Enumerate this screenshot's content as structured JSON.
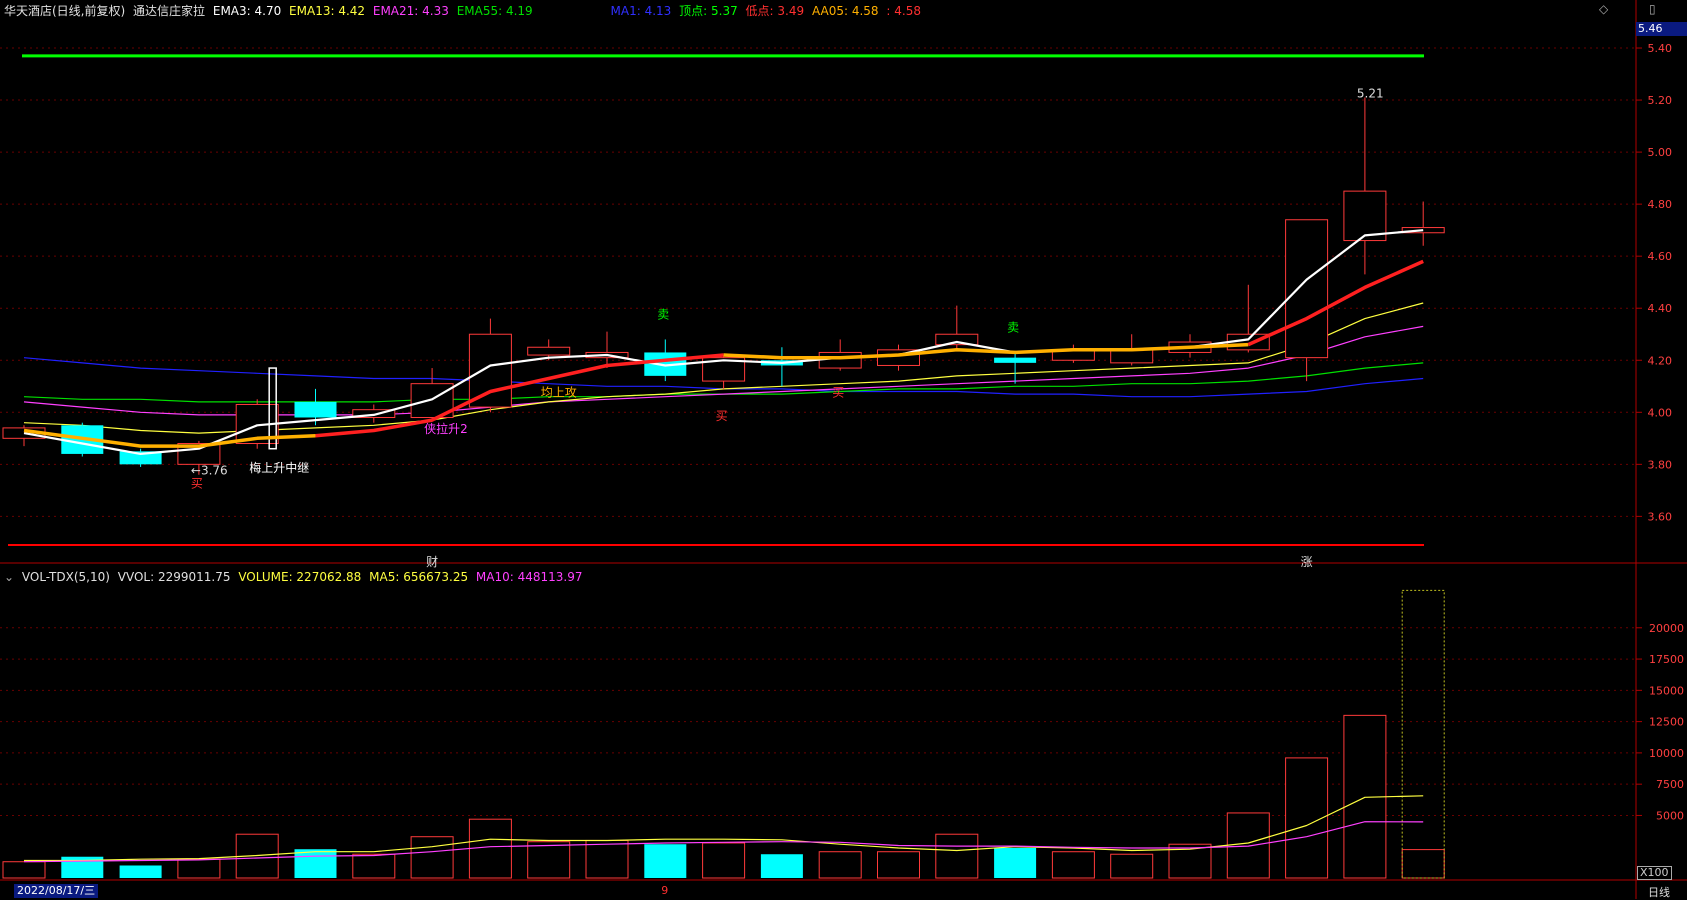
{
  "main_header": {
    "stock": "华天酒店(日线,前复权)",
    "indicator": "通达信庄家拉",
    "ema3": "EMA3: 4.70",
    "ema13": "EMA13: 4.42",
    "ema21": "EMA21: 4.33",
    "ema55": "EMA55: 4.19",
    "ma1": "MA1: 4.13",
    "top": "顶点: 5.37",
    "low": "低点: 3.49",
    "aa05": "AA05: 4.58",
    "aa05_tail": ": 4.58"
  },
  "vol_header": {
    "name": "VOL-TDX(5,10)",
    "vvol": "VVOL: 2299011.75",
    "volume": "VOLUME: 227062.88",
    "ma5": "MA5: 656673.25",
    "ma10": "MA10: 448113.97"
  },
  "labels": {
    "price_box": "5.46",
    "date": "2022/08/17/三",
    "scale": "X100",
    "period": "日线",
    "diamond_icon": "◇",
    "window_icon": "▯"
  },
  "colors": {
    "bg": "#000000",
    "up": "#ff3a3a",
    "down": "#00ffff",
    "ema3": "#ffffff",
    "ema13": "#ffff40",
    "ema21": "#ff40ff",
    "ema55": "#00e000",
    "ma1": "#2020ff",
    "aa05": "#ff2020",
    "top_line": "#00ff00",
    "low_line": "#ff0000"
  },
  "chart_data": [
    {
      "type": "candlestick",
      "title": "华天酒店(日线,前复权)",
      "y_ticks": [
        3.6,
        3.8,
        4.0,
        4.2,
        4.4,
        4.6,
        4.8,
        5.0,
        5.2,
        5.4
      ],
      "ylim": [
        3.44,
        5.5
      ],
      "top_line": 5.37,
      "low_line": 3.49,
      "candles": [
        {
          "o": 3.9,
          "c": 3.94,
          "h": 3.95,
          "l": 3.87
        },
        {
          "o": 3.95,
          "c": 3.84,
          "h": 3.96,
          "l": 3.83
        },
        {
          "o": 3.85,
          "c": 3.8,
          "h": 3.86,
          "l": 3.79
        },
        {
          "o": 3.8,
          "c": 3.88,
          "h": 3.89,
          "l": 3.76
        },
        {
          "o": 3.88,
          "c": 4.03,
          "h": 4.05,
          "l": 3.86
        },
        {
          "o": 4.04,
          "c": 3.98,
          "h": 4.09,
          "l": 3.95
        },
        {
          "o": 3.98,
          "c": 4.01,
          "h": 4.03,
          "l": 3.96
        },
        {
          "o": 3.98,
          "c": 4.11,
          "h": 4.17,
          "l": 3.97
        },
        {
          "o": 4.02,
          "c": 4.3,
          "h": 4.36,
          "l": 4.0
        },
        {
          "o": 4.22,
          "c": 4.25,
          "h": 4.28,
          "l": 4.2
        },
        {
          "o": 4.21,
          "c": 4.23,
          "h": 4.31,
          "l": 4.17
        },
        {
          "o": 4.23,
          "c": 4.14,
          "h": 4.28,
          "l": 4.12
        },
        {
          "o": 4.12,
          "c": 4.21,
          "h": 4.22,
          "l": 4.09
        },
        {
          "o": 4.2,
          "c": 4.18,
          "h": 4.25,
          "l": 4.1
        },
        {
          "o": 4.17,
          "c": 4.23,
          "h": 4.28,
          "l": 4.16
        },
        {
          "o": 4.18,
          "c": 4.24,
          "h": 4.26,
          "l": 4.16
        },
        {
          "o": 4.26,
          "c": 4.3,
          "h": 4.41,
          "l": 4.24
        },
        {
          "o": 4.21,
          "c": 4.19,
          "h": 4.23,
          "l": 4.11
        },
        {
          "o": 4.2,
          "c": 4.24,
          "h": 4.26,
          "l": 4.19
        },
        {
          "o": 4.19,
          "c": 4.24,
          "h": 4.3,
          "l": 4.18
        },
        {
          "o": 4.23,
          "c": 4.27,
          "h": 4.3,
          "l": 4.21
        },
        {
          "o": 4.24,
          "c": 4.3,
          "h": 4.49,
          "l": 4.23
        },
        {
          "o": 4.21,
          "c": 4.74,
          "h": 4.74,
          "l": 4.12
        },
        {
          "o": 4.66,
          "c": 4.85,
          "h": 5.21,
          "l": 4.53
        },
        {
          "o": 4.69,
          "c": 4.71,
          "h": 4.81,
          "l": 4.64
        }
      ],
      "ema3": [
        3.92,
        3.88,
        3.84,
        3.86,
        3.95,
        3.97,
        3.99,
        4.05,
        4.18,
        4.21,
        4.22,
        4.18,
        4.2,
        4.19,
        4.21,
        4.22,
        4.27,
        4.23,
        4.24,
        4.24,
        4.25,
        4.28,
        4.51,
        4.68,
        4.7
      ],
      "ema13": [
        3.96,
        3.95,
        3.93,
        3.92,
        3.93,
        3.94,
        3.95,
        3.97,
        4.01,
        4.04,
        4.06,
        4.07,
        4.09,
        4.1,
        4.11,
        4.12,
        4.14,
        4.15,
        4.16,
        4.17,
        4.18,
        4.19,
        4.26,
        4.36,
        4.42
      ],
      "ema21": [
        4.04,
        4.02,
        4.0,
        3.99,
        3.99,
        3.99,
        3.99,
        4.0,
        4.02,
        4.04,
        4.05,
        4.06,
        4.07,
        4.08,
        4.09,
        4.1,
        4.11,
        4.12,
        4.13,
        4.14,
        4.15,
        4.17,
        4.22,
        4.29,
        4.33
      ],
      "ema55": [
        4.06,
        4.05,
        4.05,
        4.04,
        4.04,
        4.04,
        4.04,
        4.05,
        4.05,
        4.06,
        4.06,
        4.07,
        4.07,
        4.07,
        4.08,
        4.09,
        4.09,
        4.1,
        4.1,
        4.11,
        4.11,
        4.12,
        4.14,
        4.17,
        4.19
      ],
      "ma1": [
        4.21,
        4.19,
        4.17,
        4.16,
        4.15,
        4.14,
        4.13,
        4.13,
        4.12,
        4.11,
        4.1,
        4.1,
        4.09,
        4.09,
        4.08,
        4.08,
        4.08,
        4.07,
        4.07,
        4.06,
        4.06,
        4.07,
        4.08,
        4.11,
        4.13
      ],
      "aa05": [
        3.93,
        3.9,
        3.87,
        3.87,
        3.9,
        3.91,
        3.93,
        3.97,
        4.08,
        4.13,
        4.18,
        4.2,
        4.22,
        4.21,
        4.21,
        4.22,
        4.24,
        4.23,
        4.24,
        4.24,
        4.25,
        4.26,
        4.36,
        4.48,
        4.58
      ],
      "aa05_segments": [
        {
          "from": 0,
          "to": 5,
          "color": "#ffb000"
        },
        {
          "from": 5,
          "to": 12,
          "color": "#ff2020"
        },
        {
          "from": 12,
          "to": 21,
          "color": "#ffb000"
        },
        {
          "from": 21,
          "to": 24,
          "color": "#ff2020"
        }
      ],
      "annotations": [
        {
          "i": 3,
          "price": 3.76,
          "text": "←3.76",
          "color": "#dddddd"
        },
        {
          "i": 3,
          "price": 3.71,
          "text": "买",
          "color": "#ff3030"
        },
        {
          "i": 4,
          "price": 3.77,
          "text": "梅上升中继",
          "color": "#ffffff"
        },
        {
          "i": 7,
          "price": 3.92,
          "text": "侠拉升2",
          "color": "#ff40ff"
        },
        {
          "i": 9,
          "price": 4.06,
          "text": "均上攻",
          "color": "#ffb000"
        },
        {
          "i": 11,
          "price": 4.36,
          "text": "卖",
          "color": "#00ff00"
        },
        {
          "i": 12,
          "price": 3.97,
          "text": "买",
          "color": "#ff3030"
        },
        {
          "i": 14,
          "price": 4.06,
          "text": "买",
          "color": "#ff3030"
        },
        {
          "i": 17,
          "price": 4.31,
          "text": "卖",
          "color": "#00ff00"
        },
        {
          "i": 23,
          "price": 5.21,
          "text": "5.21",
          "color": "#dddddd"
        }
      ],
      "bottom_marks": [
        {
          "i": 7,
          "text": "财",
          "color": "#dddddd"
        },
        {
          "i": 22,
          "text": "涨",
          "color": "#dddddd"
        }
      ]
    },
    {
      "type": "bar",
      "title": "VOL-TDX(5,10)",
      "y_ticks": [
        5000,
        7500,
        10000,
        12500,
        15000,
        17500,
        20000
      ],
      "ylim": [
        0,
        23500
      ],
      "unit": "X100",
      "volumes": [
        1300,
        1700,
        1000,
        1500,
        3500,
        2300,
        1900,
        3300,
        4700,
        2900,
        3000,
        2700,
        2800,
        1900,
        2100,
        2100,
        3500,
        2400,
        2100,
        1900,
        2700,
        5200,
        9600,
        13000,
        2270
      ],
      "latest_total": 22990,
      "ma5": [
        1400,
        1400,
        1500,
        1550,
        1800,
        2100,
        2100,
        2500,
        3100,
        3000,
        3000,
        3100,
        3100,
        3050,
        2700,
        2400,
        2200,
        2500,
        2400,
        2200,
        2300,
        2800,
        4200,
        6450,
        6567
      ],
      "ma10": [
        1300,
        1350,
        1400,
        1450,
        1600,
        1750,
        1800,
        2100,
        2500,
        2600,
        2700,
        2800,
        2850,
        2900,
        2850,
        2600,
        2550,
        2550,
        2450,
        2400,
        2400,
        2550,
        3300,
        4500,
        4481
      ],
      "bottom_marks": [
        {
          "i": 11,
          "text": "9",
          "color": "#ff3030"
        }
      ]
    }
  ]
}
